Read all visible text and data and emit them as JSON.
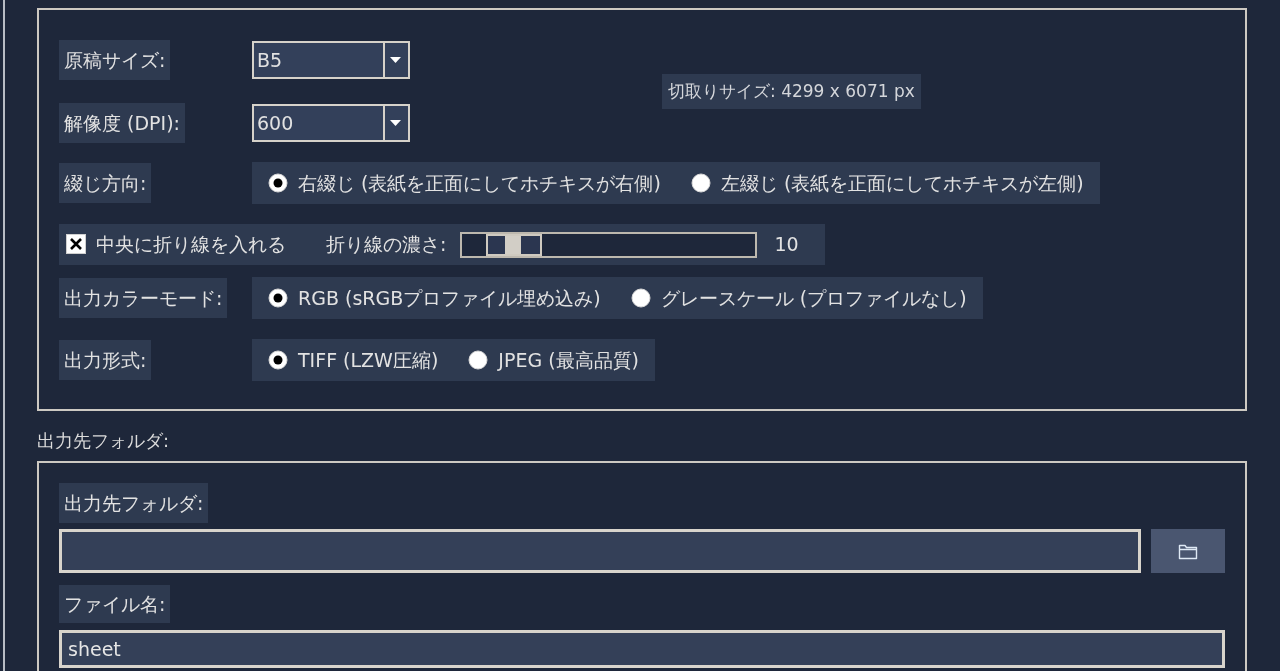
{
  "crop_settings": {
    "paper_size": {
      "label": "原稿サイズ:",
      "value": "B5"
    },
    "resolution": {
      "label": "解像度 (DPI):",
      "value": "600"
    },
    "crop_size": "切取りサイズ: 4299 x 6071 px",
    "binding": {
      "label": "綴じ方向:",
      "options": [
        {
          "label": "右綴じ (表紙を正面にしてホチキスが右側)",
          "selected": true
        },
        {
          "label": "左綴じ (表紙を正面にしてホチキスが左側)",
          "selected": false
        }
      ]
    },
    "fold_line": {
      "label": "中央に折り線を入れる",
      "checked": true,
      "density_label": "折り線の濃さ:",
      "level": 0.1,
      "reading": "10"
    },
    "color_mode": {
      "label": "出力カラーモード:",
      "options": [
        {
          "label": "RGB (sRGBプロファイル埋め込み)",
          "selected": true
        },
        {
          "label": "グレースケール (プロファイルなし)",
          "selected": false
        }
      ]
    },
    "output_format": {
      "label": "出力形式:",
      "options": [
        {
          "label": "TIFF (LZW圧縮)",
          "selected": true
        },
        {
          "label": "JPEG (最高品質)",
          "selected": false
        }
      ]
    }
  },
  "output": {
    "group_title": "出力先フォルダ:",
    "folder": {
      "label": "出力先フォルダ:"
    },
    "file_name": {
      "label": "ファイル名:",
      "value": "sheet"
    }
  }
}
